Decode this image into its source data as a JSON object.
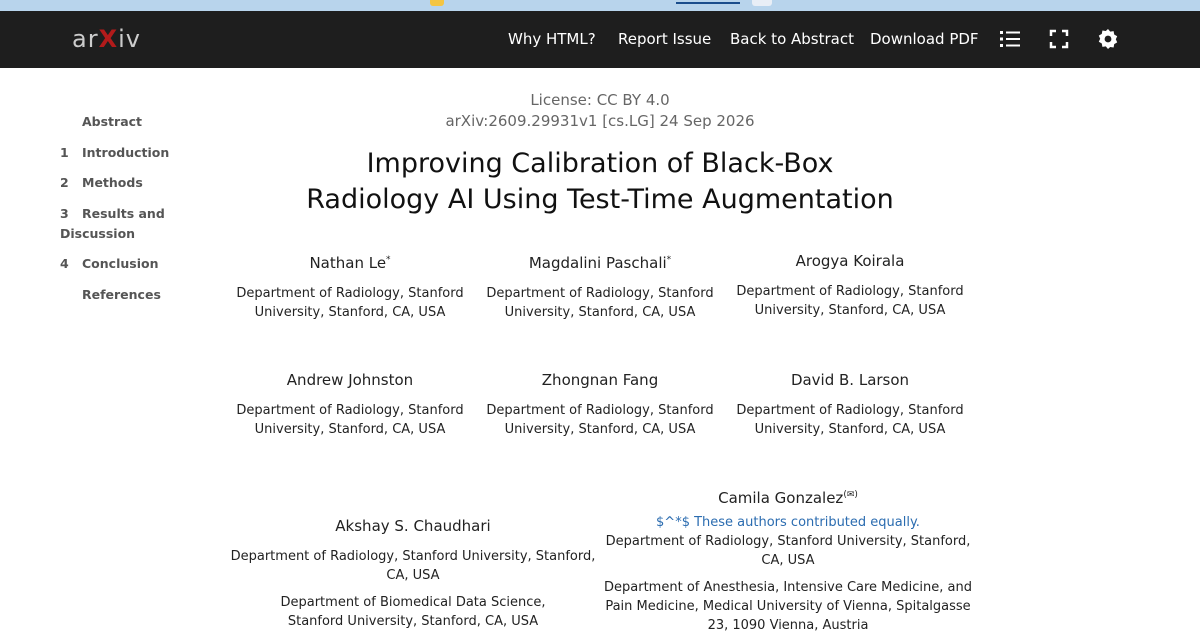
{
  "nav": {
    "logo": "arxiv",
    "links": [
      "Why HTML?",
      "Report Issue",
      "Back to Abstract",
      "Download PDF"
    ],
    "icons": [
      "list-icon",
      "fullscreen-icon",
      "settings-icon"
    ]
  },
  "toc": [
    {
      "num": "",
      "label": "Abstract"
    },
    {
      "num": "1",
      "label": "Introduction"
    },
    {
      "num": "2",
      "label": "Methods"
    },
    {
      "num": "3",
      "label": "Results and Discussion"
    },
    {
      "num": "4",
      "label": "Conclusion"
    },
    {
      "num": "",
      "label": "References"
    }
  ],
  "header": {
    "license": "License: CC BY 4.0",
    "arxiv_id": "arXiv:2609.29931v1 [cs.LG] 24 Sep 2026",
    "title": "Improving Calibration of Black-Box Radiology AI Using Test-Time Augmentation"
  },
  "authors": [
    {
      "name": "Nathan Le",
      "mark": "*",
      "aff": "Department of Radiology, Stanford University, Stanford, CA, USA"
    },
    {
      "name": "Magdalini Paschali",
      "mark": "*",
      "aff": "Department of Radiology, Stanford University, Stanford, CA, USA"
    },
    {
      "name": "Arogya Koirala",
      "mark": "",
      "aff": "Department of Radiology, Stanford University, Stanford, CA, USA"
    },
    {
      "name": "Andrew Johnston",
      "mark": "",
      "aff": "Department of Radiology, Stanford University, Stanford, CA, USA"
    },
    {
      "name": "Zhongnan Fang",
      "mark": "",
      "aff": "Department of Radiology, Stanford University, Stanford, CA, USA"
    },
    {
      "name": "David B. Larson",
      "mark": "",
      "aff": "Department of Radiology, Stanford University, Stanford, CA, USA"
    },
    {
      "name": "Akshay S. Chaudhari",
      "mark": "",
      "aff": "Department of Radiology, Stanford University, Stanford, CA, USA",
      "aff2": "Department of Biomedical Data Science, Stanford University, Stanford, CA, USA"
    },
    {
      "name": "Camila Gonzalez",
      "mark": "(✉)",
      "note": "$^*$ These authors contributed equally.",
      "aff": "Department of Radiology, Stanford University, Stanford, CA, USA",
      "aff2": "Department of Anesthesia, Intensive Care Medicine, and Pain Medicine, Medical University of Vienna, Spitalgasse 23, 1090 Vienna, Austria"
    }
  ]
}
